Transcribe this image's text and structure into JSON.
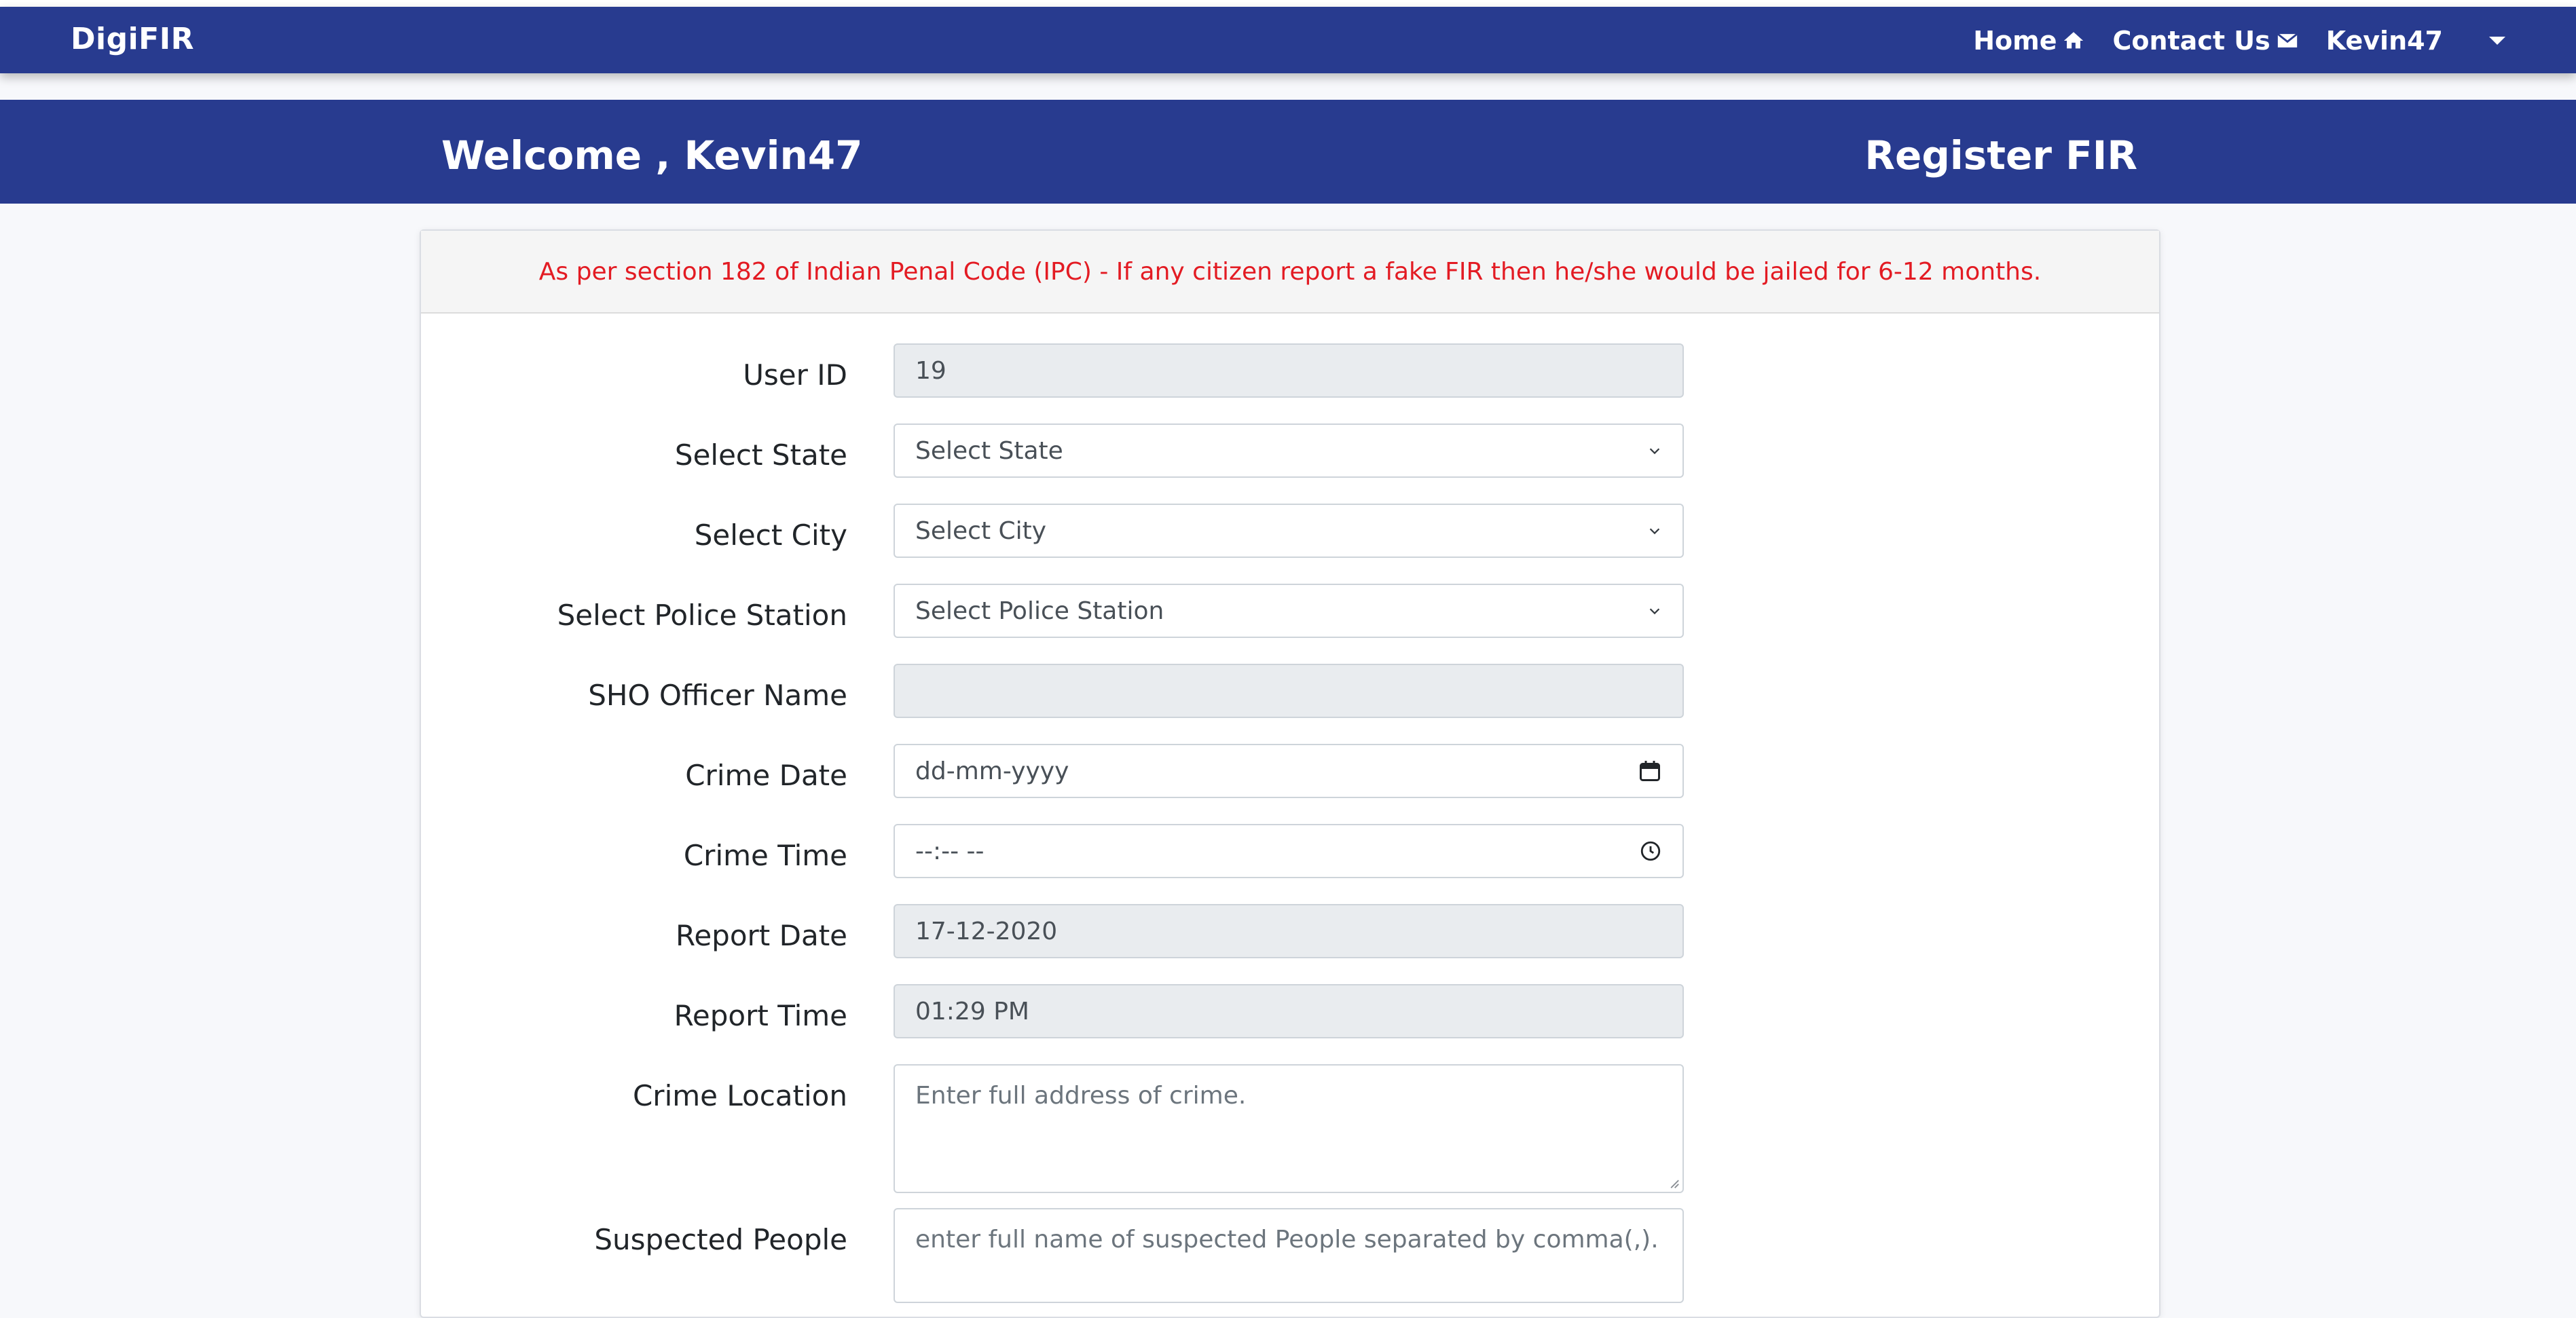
{
  "nav": {
    "brand": "DigiFIR",
    "home": "Home",
    "contact": "Contact Us",
    "user": "Kevin47"
  },
  "banner": {
    "welcome": "Welcome , Kevin47",
    "title": "Register FIR"
  },
  "notice": "As per section 182 of Indian Penal Code (IPC) - If any citizen report a fake FIR then he/she would be jailed for 6-12 months.",
  "form": {
    "user_id": {
      "label": "User ID",
      "value": "19"
    },
    "state": {
      "label": "Select State",
      "selected": "Select State"
    },
    "city": {
      "label": "Select City",
      "selected": "Select City"
    },
    "police_station": {
      "label": "Select Police Station",
      "selected": "Select Police Station"
    },
    "sho": {
      "label": "SHO Officer Name",
      "value": ""
    },
    "crime_date": {
      "label": "Crime Date",
      "placeholder": "dd-mm-yyyy"
    },
    "crime_time": {
      "label": "Crime Time",
      "placeholder": "--:-- --"
    },
    "report_date": {
      "label": "Report Date",
      "value": "17-12-2020"
    },
    "report_time": {
      "label": "Report Time",
      "value": "01:29 PM"
    },
    "crime_location": {
      "label": "Crime Location",
      "placeholder": "Enter full address of crime."
    },
    "suspected": {
      "label": "Suspected People",
      "placeholder": "enter full name of suspected People separated by comma(,)."
    }
  },
  "colors": {
    "primary": "#283b8f",
    "warning": "#e31b23",
    "readonly_bg": "#e9ecef"
  }
}
